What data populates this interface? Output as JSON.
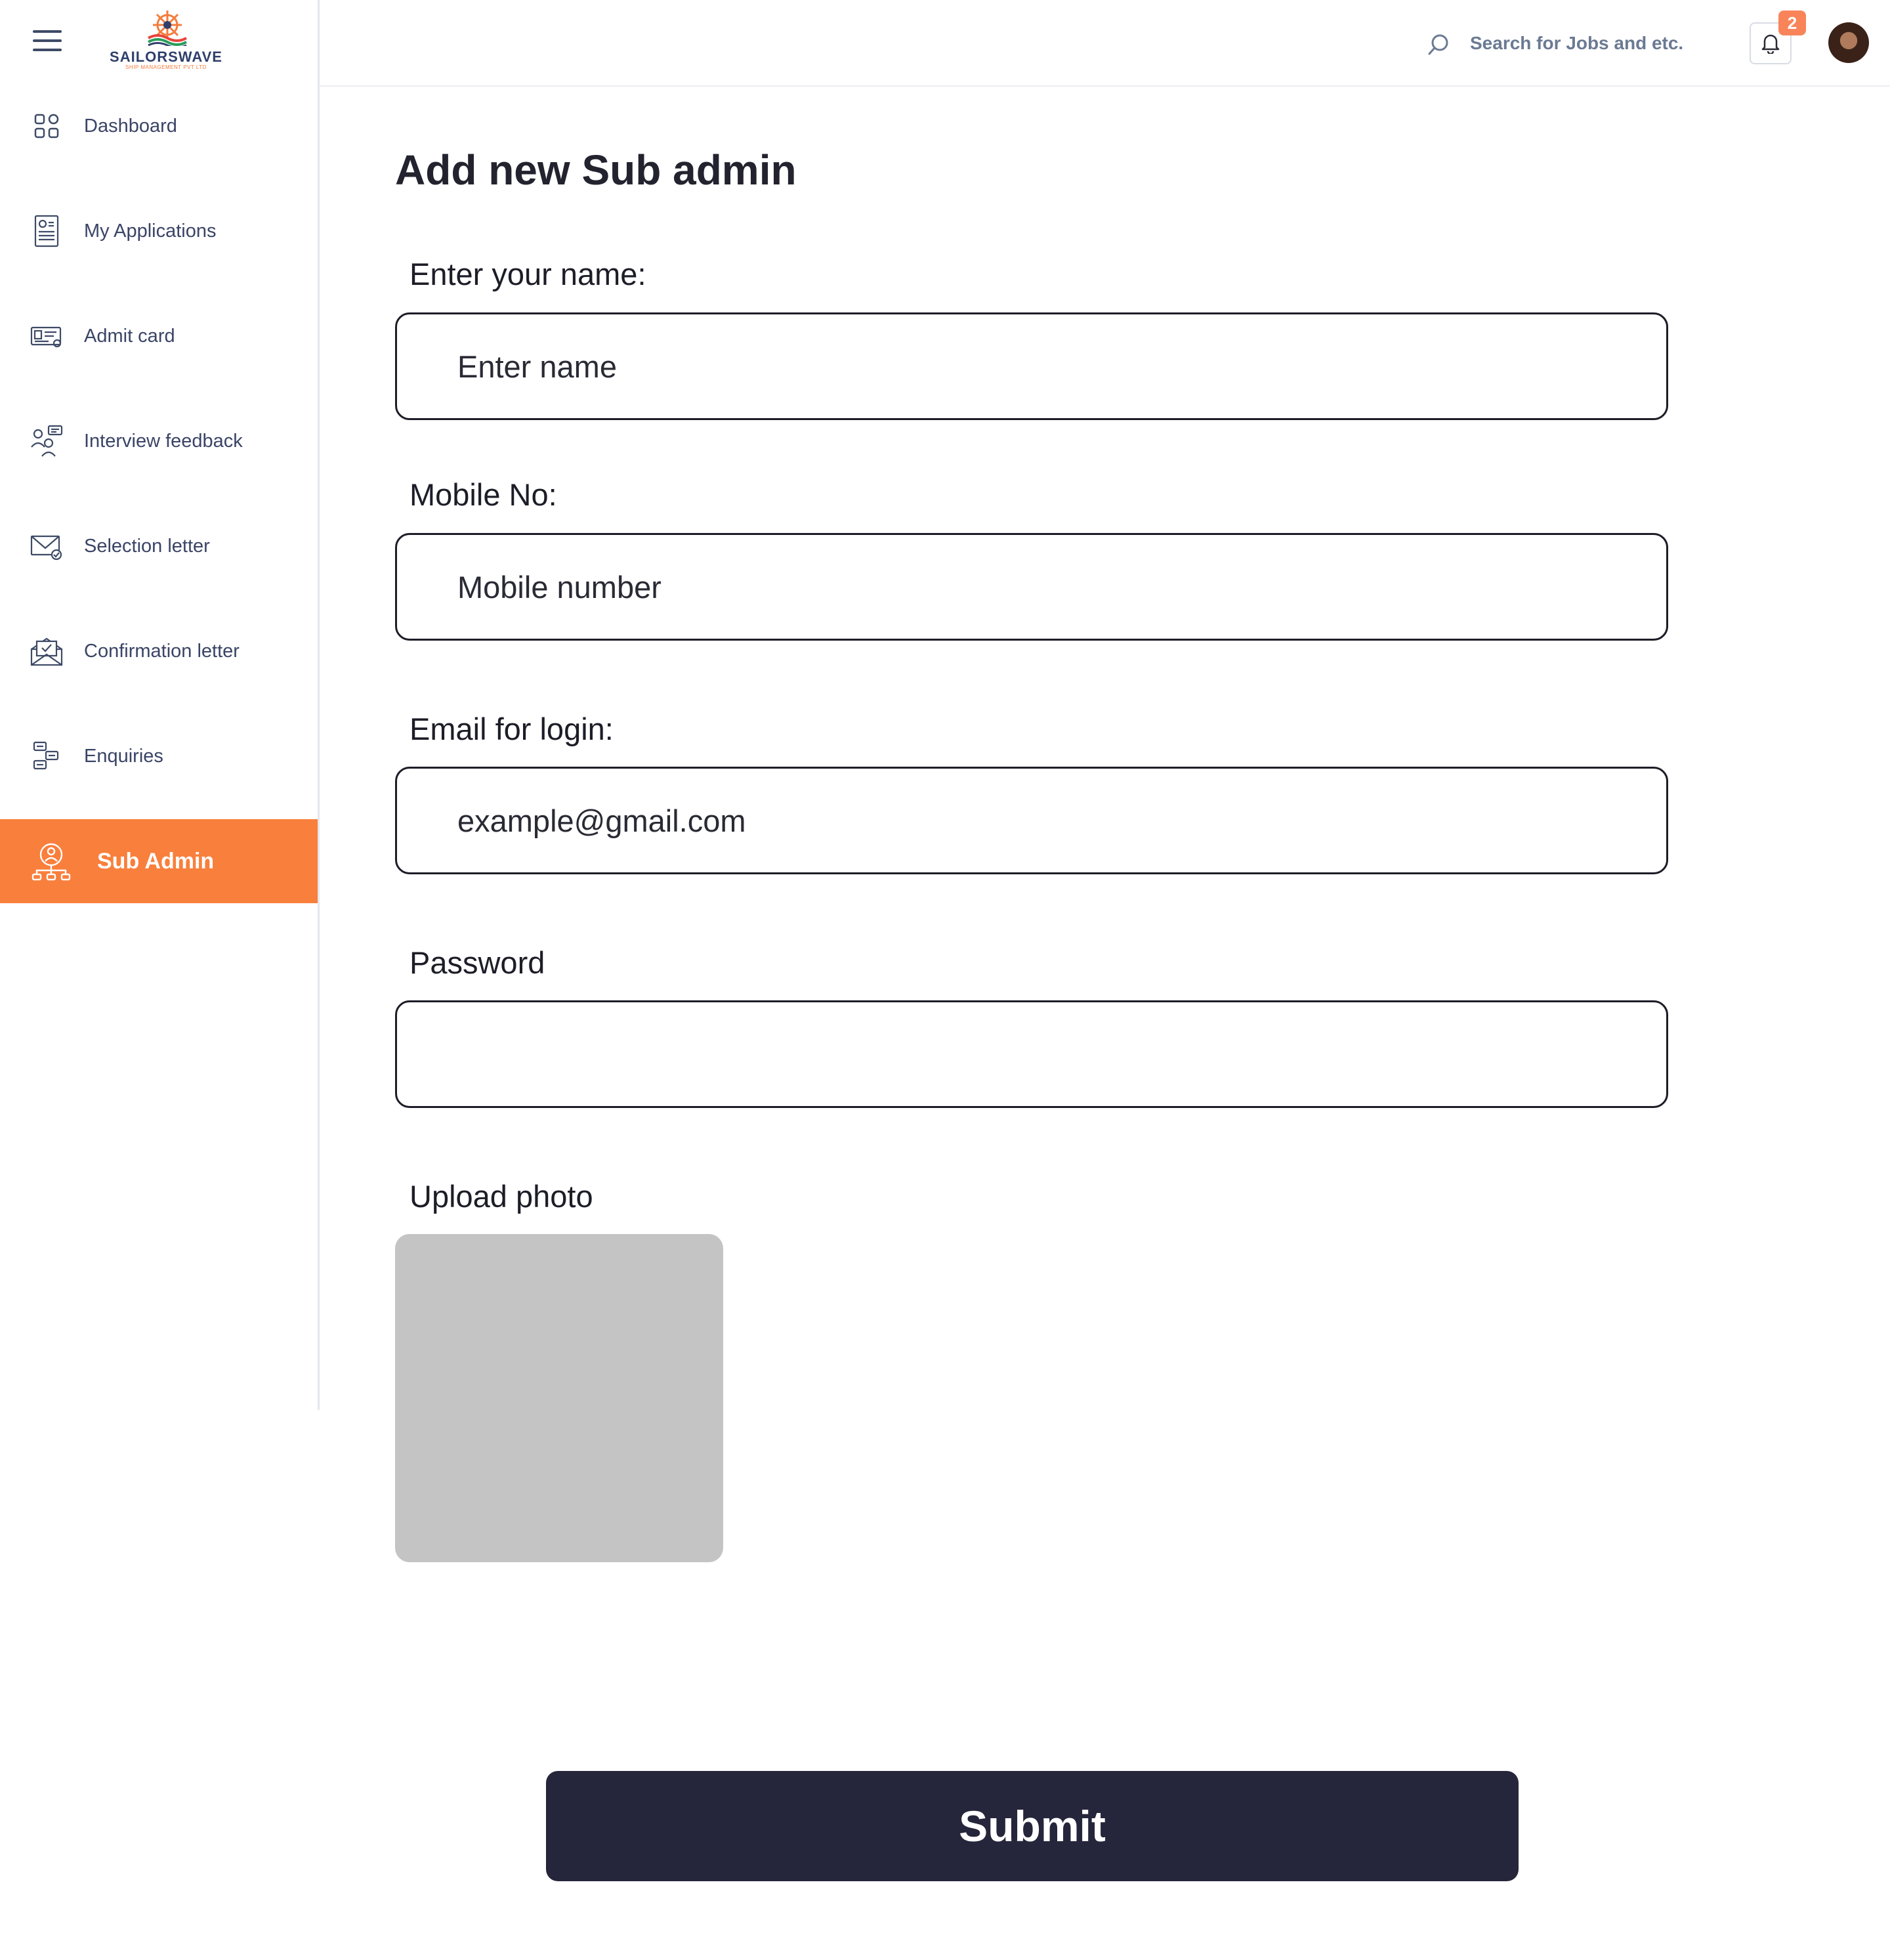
{
  "brand": {
    "name": "SAILORSWAVE",
    "tagline": "SHIP MANAGEMENT PVT LTD",
    "colors": {
      "accent": "#f97f3c",
      "navy": "#2f3f6c",
      "button": "#25253b"
    }
  },
  "sidebar": {
    "menu_icon": "hamburger-icon",
    "items": [
      {
        "label": "Dashboard",
        "icon": "grid-icon",
        "active": false
      },
      {
        "label": "My Applications",
        "icon": "application-document-icon",
        "active": false
      },
      {
        "label": "Admit card",
        "icon": "id-card-icon",
        "active": false
      },
      {
        "label": "Interview feedback",
        "icon": "interview-icon",
        "active": false
      },
      {
        "label": "Selection letter",
        "icon": "mail-check-icon",
        "active": false
      },
      {
        "label": "Confirmation letter",
        "icon": "open-envelope-icon",
        "active": false
      },
      {
        "label": "Enquiries",
        "icon": "enquiry-chat-icon",
        "active": false
      },
      {
        "label": "Sub Admin",
        "icon": "org-chart-icon",
        "active": true
      }
    ]
  },
  "header": {
    "search_placeholder": "Search for Jobs and etc.",
    "notification_count": "2"
  },
  "form": {
    "title": "Add new Sub admin",
    "name_label": "Enter your name:",
    "name_placeholder": "Enter name",
    "mobile_label": "Mobile No:",
    "mobile_placeholder": "Mobile number",
    "email_label": "Email for login:",
    "email_placeholder": "example@gmail.com",
    "password_label": "Password",
    "password_placeholder": "",
    "photo_label": "Upload photo",
    "submit_label": "Submit"
  }
}
